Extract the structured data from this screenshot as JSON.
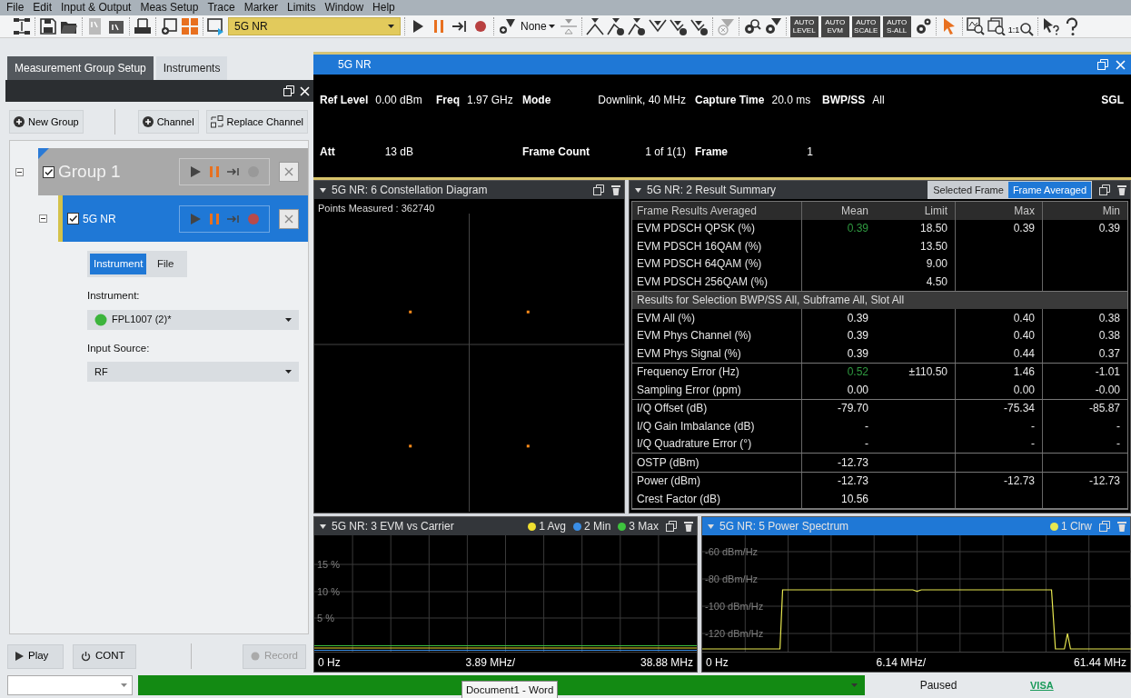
{
  "menu": [
    "File",
    "Edit",
    "Input & Output",
    "Meas Setup",
    "Trace",
    "Marker",
    "Limits",
    "Window",
    "Help"
  ],
  "toolbar": {
    "measurement": "5G NR",
    "marker_mode": "None",
    "auto_buttons": [
      "AUTO LEVEL",
      "AUTO EVM",
      "AUTO SCALE",
      "AUTO S-ALL"
    ],
    "zoom_ratio": "1:1"
  },
  "left_panel": {
    "tabs": [
      {
        "label": "Measurement Group Setup",
        "selected": true
      },
      {
        "label": "Instruments",
        "selected": false
      }
    ],
    "buttons": [
      "New Group",
      "Channel",
      "Replace Channel"
    ],
    "tree": [
      {
        "name": "Group 1",
        "checked": true,
        "expanded": true,
        "selected": false,
        "record_enabled": false,
        "children": [
          {
            "name": "5G NR",
            "checked": true,
            "expanded": true,
            "selected": true,
            "record_enabled": true,
            "source_toggle": [
              {
                "label": "Instrument",
                "selected": true
              },
              {
                "label": "File",
                "selected": false
              }
            ],
            "fields": [
              {
                "label": "Instrument:",
                "value": "FPL1007 (2)*",
                "color": "#3cb43c"
              },
              {
                "label": "Input Source:",
                "value": "RF"
              }
            ]
          }
        ]
      }
    ],
    "footer_buttons": [
      {
        "label": "Play",
        "kind": "play",
        "disabled": false
      },
      {
        "label": "CONT",
        "kind": "cont",
        "disabled": false
      },
      {
        "label": "Record",
        "kind": "record",
        "disabled": true
      }
    ]
  },
  "channel": {
    "title": "5G NR",
    "params": [
      [
        {
          "label": "Ref Level",
          "value": "0.00 dBm"
        },
        {
          "label": "Freq",
          "value": "1.97 GHz"
        },
        {
          "label": "Mode",
          "value": "Downlink, 40 MHz"
        },
        {
          "label": "Capture Time",
          "value": "20.0 ms"
        },
        {
          "label": "BWP/SS",
          "value": "All"
        }
      ],
      [
        {
          "label": "Att",
          "value": "13 dB"
        },
        {
          "label": "Frame Count",
          "value": "1 of 1(1)"
        },
        {
          "label": "Frame",
          "value": "1"
        }
      ]
    ],
    "sweep_mode": "SGL"
  },
  "panels": [
    {
      "kind": "constellation",
      "title": "5G NR: 6 Constellation Diagram",
      "selected": false,
      "caption": "Points Measured : 362740"
    },
    {
      "kind": "result_summary",
      "title": "5G NR: 2 Result Summary",
      "selected": false,
      "view_toggle": [
        {
          "label": "Selected Frame",
          "selected": false
        },
        {
          "label": "Frame Averaged",
          "selected": true
        }
      ],
      "columns": [
        "Frame Results Averaged",
        "Mean",
        "Limit",
        "Max",
        "Min"
      ],
      "blocks": [
        {
          "kind": "rows",
          "groups": [
            [
              {
                "label": "EVM PDSCH QPSK (%)",
                "mean": "0.39",
                "limit": "18.50",
                "max": "0.39",
                "min": "0.39",
                "mean_pass": true
              },
              {
                "label": "EVM PDSCH 16QAM (%)",
                "limit": "13.50"
              },
              {
                "label": "EVM PDSCH 64QAM (%)",
                "limit": "9.00"
              },
              {
                "label": "EVM PDSCH 256QAM (%)",
                "limit": "4.50"
              }
            ]
          ]
        },
        {
          "kind": "heading",
          "text": "Results for Selection  BWP/SS All,  Subframe All,  Slot All"
        },
        {
          "kind": "rows",
          "groups": [
            [
              {
                "label": "EVM All (%)",
                "mean": "0.39",
                "max": "0.40",
                "min": "0.38",
                "mean_pass": false
              },
              {
                "label": "EVM Phys Channel (%)",
                "mean": "0.39",
                "max": "0.40",
                "min": "0.38",
                "mean_pass": false
              },
              {
                "label": "EVM Phys Signal (%)",
                "mean": "0.39",
                "max": "0.44",
                "min": "0.37",
                "mean_pass": false
              }
            ],
            [
              {
                "label": "Frequency Error (Hz)",
                "mean": "0.52",
                "limit": "±110.50",
                "max": "1.46",
                "min": "-1.01",
                "mean_pass": true
              },
              {
                "label": "Sampling Error (ppm)",
                "mean": "0.00",
                "max": "0.00",
                "min": "-0.00",
                "mean_pass": false
              }
            ],
            [
              {
                "label": "I/Q Offset (dB)",
                "mean": "-79.70",
                "max": "-75.34",
                "min": "-85.87",
                "mean_pass": false
              },
              {
                "label": "I/Q Gain Imbalance (dB)",
                "mean": "-",
                "max": "-",
                "min": "-",
                "mean_pass": false
              },
              {
                "label": "I/Q Quadrature Error (°)",
                "mean": "-",
                "max": "-",
                "min": "-",
                "mean_pass": false
              }
            ],
            [
              {
                "label": "OSTP (dBm)",
                "mean": "-12.73",
                "mean_pass": false
              }
            ],
            [
              {
                "label": "Power (dBm)",
                "mean": "-12.73",
                "max": "-12.73",
                "min": "-12.73",
                "mean_pass": false
              },
              {
                "label": "Crest Factor (dB)",
                "mean": "10.56",
                "mean_pass": false
              }
            ]
          ]
        }
      ]
    },
    {
      "kind": "evm",
      "title": "5G NR: 3 EVM vs Carrier",
      "selected": false,
      "x_labels": [
        "0 Hz",
        "3.89 MHz/",
        "38.88 MHz"
      ],
      "y_labels": [
        "15 %",
        "10 %",
        "5 %"
      ],
      "legend": [
        {
          "name": "1 Avg",
          "color": "#f0e030"
        },
        {
          "name": "2 Min",
          "color": "#3a8ee6"
        },
        {
          "name": "3 Max",
          "color": "#3ec43e"
        }
      ]
    },
    {
      "kind": "spectrum",
      "title": "5G NR: 5 Power Spectrum",
      "selected": true,
      "x_labels": [
        "0 Hz",
        "6.14 MHz/",
        "61.44 MHz"
      ],
      "y_labels": [
        "-60 dBm/Hz",
        "-80 dBm/Hz",
        "-100 dBm/Hz",
        "-120 dBm/Hz"
      ],
      "legend": [
        {
          "name": "1 Clrw",
          "color": "#e8e850"
        }
      ]
    }
  ],
  "status_bar": {
    "tooltip": "Document1 - Word",
    "state": "Paused",
    "interface": "VISA"
  }
}
